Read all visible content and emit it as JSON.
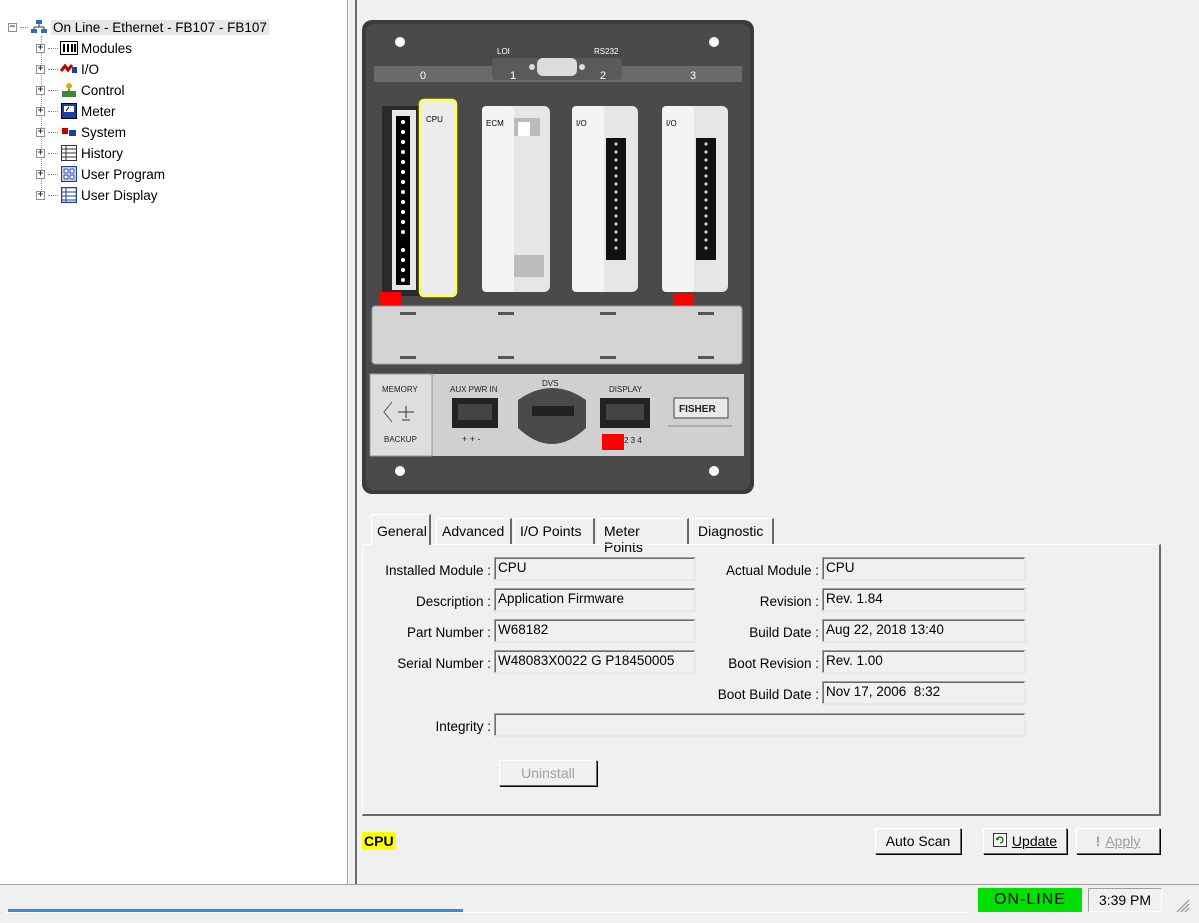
{
  "tree": {
    "root": "On Line - Ethernet - FB107 - FB107",
    "items": [
      {
        "label": "Modules",
        "icon": "modules-icon"
      },
      {
        "label": "I/O",
        "icon": "io-icon"
      },
      {
        "label": "Control",
        "icon": "control-icon"
      },
      {
        "label": "Meter",
        "icon": "meter-icon"
      },
      {
        "label": "System",
        "icon": "system-icon"
      },
      {
        "label": "History",
        "icon": "history-icon"
      },
      {
        "label": "User Program",
        "icon": "user-program-icon"
      },
      {
        "label": "User Display",
        "icon": "user-display-icon"
      }
    ]
  },
  "chassis": {
    "slot_numbers": [
      "0",
      "1",
      "2",
      "3"
    ],
    "port_loi": "LOI",
    "port_rs232": "RS232",
    "modules": [
      {
        "label": "CPU"
      },
      {
        "label": "ECM"
      },
      {
        "label": "I/O"
      },
      {
        "label": "I/O"
      }
    ],
    "memory": "MEMORY",
    "backup": "BACKUP",
    "aux_pwr": "AUX PWR IN",
    "aux_pins": "+ + -",
    "dvs": "DVS",
    "display": "DISPLAY",
    "display_pins": "2 3 4",
    "brand": "FISHER"
  },
  "tabs": [
    {
      "label": "General"
    },
    {
      "label": "Advanced"
    },
    {
      "label": "I/O Points"
    },
    {
      "label": "Meter Points"
    },
    {
      "label": "Diagnostic"
    }
  ],
  "general": {
    "installed_module_label": "Installed Module :",
    "installed_module": "CPU",
    "description_label": "Description :",
    "description": "Application Firmware",
    "part_number_label": "Part Number :",
    "part_number": "W68182",
    "serial_number_label": "Serial Number :",
    "serial_number": "W48083X0022 G P18450005",
    "actual_module_label": "Actual Module :",
    "actual_module": "CPU",
    "revision_label": "Revision :",
    "revision": "Rev. 1.84",
    "build_date_label": "Build Date :",
    "build_date": "Aug 22, 2018 13:40",
    "boot_revision_label": "Boot Revision :",
    "boot_revision": "Rev. 1.00",
    "boot_build_date_label": "Boot Build Date :",
    "boot_build_date": "Nov 17, 2006  8:32",
    "integrity_label": "Integrity :",
    "integrity": "",
    "uninstall": "Uninstall"
  },
  "selected_module": "CPU",
  "buttons": {
    "auto_scan": "Auto Scan",
    "update": "Update",
    "apply": "Apply"
  },
  "status": {
    "online": "ON-LINE",
    "time": "3:39 PM"
  },
  "colors": {
    "online_bg": "#00e000",
    "selected_highlight": "#ffff00",
    "chassis_dark": "#3b3b3b",
    "alarm_red": "#ff0000"
  }
}
